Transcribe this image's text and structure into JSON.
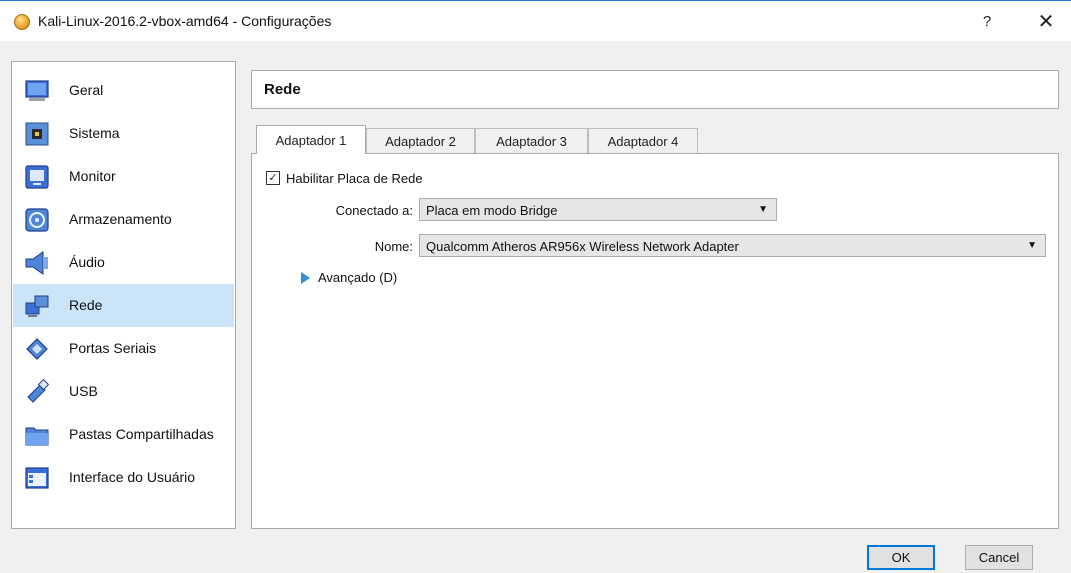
{
  "window": {
    "title": "Kali-Linux-2016.2-vbox-amd64 - Configurações",
    "help_label": "?",
    "close_label": "✕"
  },
  "sidebar": {
    "items": [
      {
        "label": "Geral",
        "icon": "monitor-screen-icon"
      },
      {
        "label": "Sistema",
        "icon": "chip-icon"
      },
      {
        "label": "Monitor",
        "icon": "display-icon"
      },
      {
        "label": "Armazenamento",
        "icon": "disk-icon"
      },
      {
        "label": "Áudio",
        "icon": "speaker-icon"
      },
      {
        "label": "Rede",
        "icon": "network-icon",
        "selected": true
      },
      {
        "label": "Portas Seriais",
        "icon": "serial-port-icon"
      },
      {
        "label": "USB",
        "icon": "usb-icon"
      },
      {
        "label": "Pastas Compartilhadas",
        "icon": "folder-icon"
      },
      {
        "label": "Interface do Usuário",
        "icon": "user-interface-icon"
      }
    ]
  },
  "main": {
    "title": "Rede",
    "tabs": [
      {
        "label": "Adaptador 1",
        "active": true
      },
      {
        "label": "Adaptador 2"
      },
      {
        "label": "Adaptador 3"
      },
      {
        "label": "Adaptador 4"
      }
    ],
    "enable_adapter": {
      "label": "Habilitar Placa de Rede",
      "checked": true,
      "check_mark": "✓"
    },
    "attached_to": {
      "label": "Conectado a:",
      "value": "Placa em modo Bridge"
    },
    "name": {
      "label": "Nome:",
      "value": "Qualcomm Atheros AR956x Wireless Network Adapter"
    },
    "advanced": {
      "label": "Avançado (D)",
      "expanded": false
    }
  },
  "buttons": {
    "ok": "OK",
    "cancel": "Cancel"
  },
  "colors": {
    "selection": "#cce4f7",
    "accent": "#0078d7",
    "expander": "#2f8fd8"
  }
}
